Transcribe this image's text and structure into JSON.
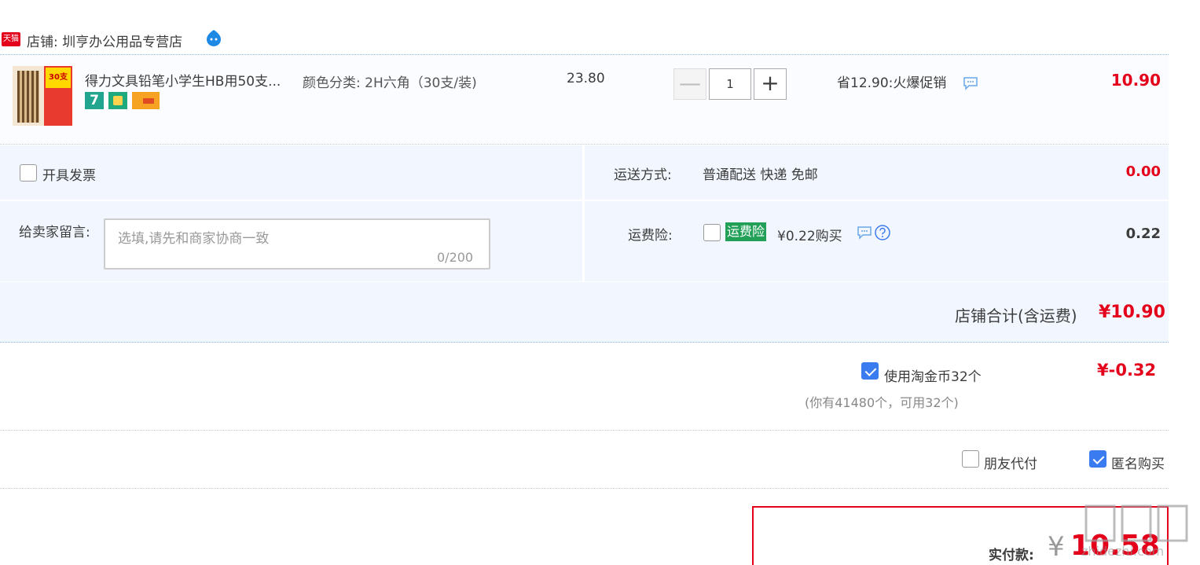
{
  "shop": {
    "badge": "天猫",
    "label": "店铺: 圳亨办公用品专营店"
  },
  "item": {
    "thumb_tag": "30支",
    "title": "得力文具铅笔小学生HB用50支...",
    "svc_seven": "7",
    "sku": "颜色分类: 2H六角（30支/装)",
    "unit_price": "23.80",
    "qty_minus": "—",
    "quantity": "1",
    "qty_plus": "+",
    "promo": "省12.90:火爆促销",
    "total": "10.90"
  },
  "invoice": {
    "label": "开具发票"
  },
  "shipping": {
    "label": "运送方式:",
    "method": "普通配送 快递 免邮",
    "fee": "0.00"
  },
  "message": {
    "label": "给卖家留言:",
    "placeholder": "选填,请先和商家协商一致",
    "count": "0/200"
  },
  "insurance": {
    "label": "运费险:",
    "badge": "运费险",
    "price_text": "¥0.22购买",
    "fee": "0.22"
  },
  "shop_total": {
    "label": "店铺合计(含运费)",
    "value": "¥10.90"
  },
  "coins": {
    "label": "使用淘金币32个",
    "note": "(你有41480个，可用32个)",
    "amount": "¥-0.32"
  },
  "options": {
    "friend_pay": "朋友代付",
    "anonymous": "匿名购买"
  },
  "payment": {
    "label": "实付款:",
    "yen": "¥",
    "value": "10.58"
  },
  "watermark": "zhidezhi.com",
  "colors": {
    "price_red": "#e4001b",
    "panel_bg": "#f2f7ff",
    "checkbox_blue": "#3b7bf0",
    "insurance_green": "#22a058"
  }
}
